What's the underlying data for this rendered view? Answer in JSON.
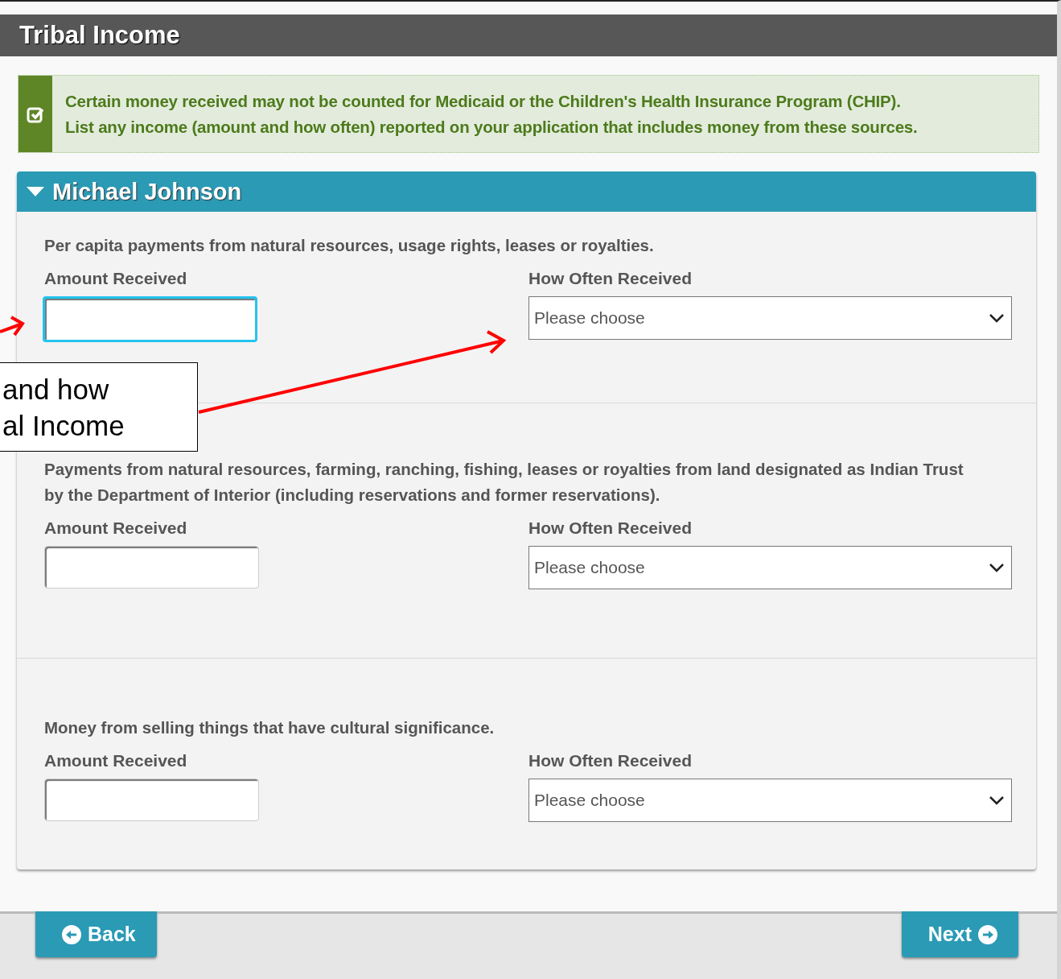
{
  "header": {
    "title": "Tribal Income"
  },
  "notice": {
    "lines": [
      "Certain money received may not be counted for Medicaid or the Children's Health Insurance Program (CHIP).",
      "List any income (amount and how often) reported on your application that includes money from these sources."
    ]
  },
  "person": {
    "name": "Michael Johnson",
    "expanded": true,
    "sections": [
      {
        "description": "Per capita payments from natural resources, usage rights, leases or royalties.",
        "amount_label": "Amount Received",
        "amount_focused": true,
        "frequency_label": "How Often Received",
        "frequency_placeholder": "Please choose"
      },
      {
        "description": "Payments from natural resources, farming, ranching, fishing, leases or royalties from land designated as Indian Trust by the Department of Interior (including reservations and former reservations).",
        "amount_label": "Amount Received",
        "amount_focused": false,
        "frequency_label": "How Often Received",
        "frequency_placeholder": "Please choose"
      },
      {
        "description": "Money from selling things that have cultural significance.",
        "amount_label": "Amount Received",
        "amount_focused": false,
        "frequency_label": "How Often Received",
        "frequency_placeholder": "Please choose"
      }
    ]
  },
  "callout": {
    "lines": [
      "and how",
      "al Income"
    ]
  },
  "footer": {
    "back": "Back",
    "next": "Next"
  }
}
